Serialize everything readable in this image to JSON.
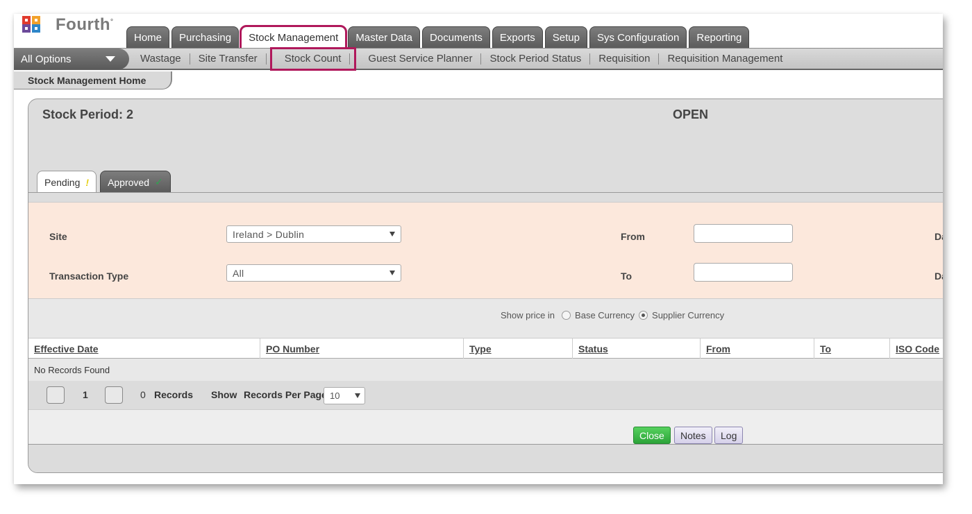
{
  "header": {
    "logo_text": "Fourth",
    "logo_mark": "°",
    "brand_colors": [
      "#e03b2e",
      "#f2a12b",
      "#2e86c8",
      "#6c4a9a"
    ]
  },
  "main_tabs": [
    {
      "label": "Home"
    },
    {
      "label": "Purchasing"
    },
    {
      "label": "Stock Management",
      "active": true
    },
    {
      "label": "Master Data"
    },
    {
      "label": "Documents"
    },
    {
      "label": "Exports"
    },
    {
      "label": "Setup"
    },
    {
      "label": "Sys Configuration"
    },
    {
      "label": "Reporting"
    }
  ],
  "subnav": {
    "all_options": "All Options",
    "items": [
      "Wastage",
      "Site Transfer",
      "Stock Count",
      "Guest Service Planner",
      "Stock Period Status",
      "Requisition",
      "Requisition Management"
    ]
  },
  "breadcrumb": "Stock Management Home",
  "panel": {
    "period_title": "Stock Period: 2",
    "period_status": "OPEN",
    "tabs": [
      {
        "label": "Pending",
        "icon": "!"
      },
      {
        "label": "Approved",
        "icon": "✓"
      }
    ]
  },
  "filters": {
    "site_label": "Site",
    "site_value": "Ireland > Dublin",
    "transaction_type_label": "Transaction Type",
    "transaction_type_value": "All",
    "from_label": "From",
    "to_label": "To",
    "from_value": "",
    "to_value": "",
    "right_label_1": "Da",
    "right_label_2": "Da"
  },
  "price": {
    "label": "Show price in",
    "options": [
      "Base Currency",
      "Supplier Currency"
    ],
    "selected": "Supplier Currency"
  },
  "table": {
    "columns": [
      "Effective Date",
      "PO Number",
      "Type",
      "Status",
      "From",
      "To",
      "ISO Code"
    ],
    "empty_text": "No Records Found"
  },
  "pager": {
    "page": "1",
    "count": "0",
    "records_label": "Records",
    "show_label": "Show",
    "per_page_label": "Records Per Page",
    "per_page_value": "10"
  },
  "buttons": {
    "close": "Close",
    "notes": "Notes",
    "log": "Log"
  },
  "highlight_color": "#b0185b"
}
